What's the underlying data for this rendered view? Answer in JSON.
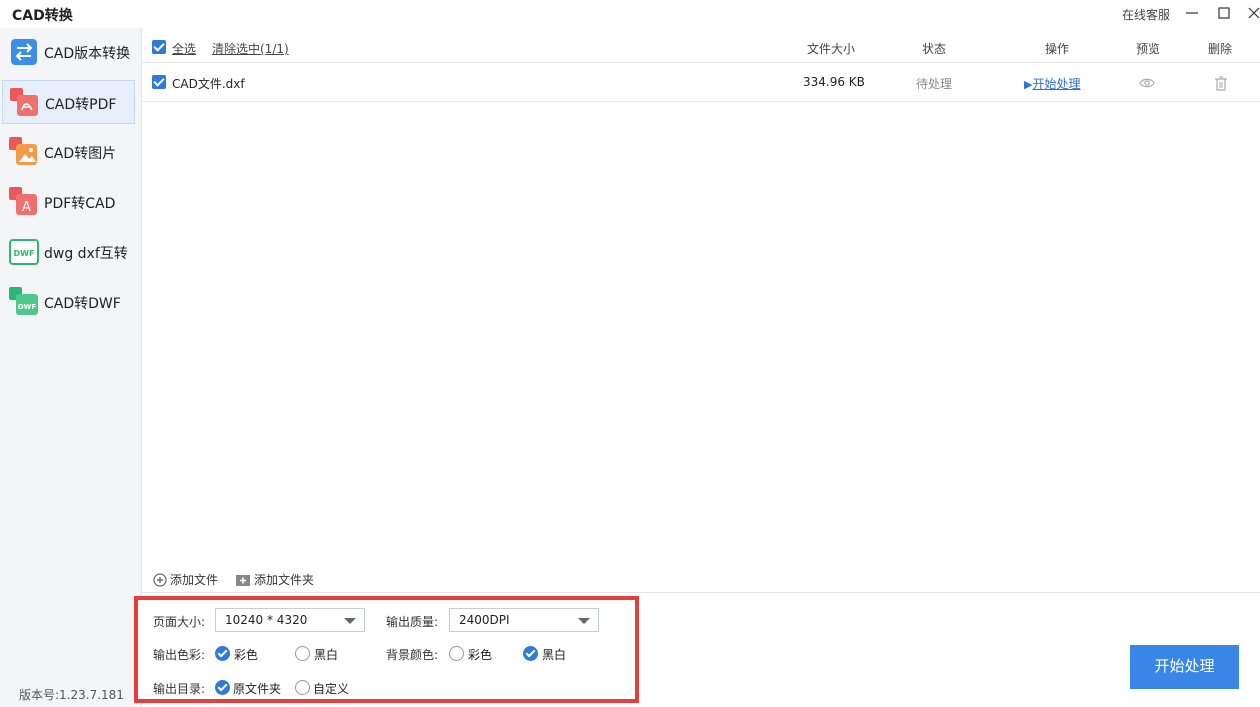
{
  "window": {
    "title": "CAD转换",
    "support_label": "在线客服"
  },
  "sidebar": {
    "items": [
      {
        "label": "CAD版本转换",
        "icon": "version-convert-icon",
        "color": "#3b8de8"
      },
      {
        "label": "CAD转PDF",
        "icon": "pdf-icon",
        "color": "#e85a5a",
        "active": true
      },
      {
        "label": "CAD转图片",
        "icon": "image-icon",
        "color": "#f08a3a"
      },
      {
        "label": "PDF转CAD",
        "icon": "pdf-to-cad-icon",
        "color": "#e85a5a"
      },
      {
        "label": "dwg dxf互转",
        "icon": "dwf-icon",
        "color": "#2bb673"
      },
      {
        "label": "CAD转DWF",
        "icon": "dwf-icon",
        "color": "#2bb673"
      }
    ],
    "version": "版本号:1.23.7.181"
  },
  "table": {
    "select_all": "全选",
    "clear_selection": "清除选中(1/1)",
    "columns": [
      "文件大小",
      "状态",
      "操作",
      "预览",
      "删除"
    ],
    "rows": [
      {
        "name": "CAD文件.dxf",
        "size": "334.96 KB",
        "status": "待处理",
        "action": "开始处理"
      }
    ]
  },
  "footer": {
    "add_file": "添加文件",
    "add_folder": "添加文件夹"
  },
  "options": {
    "page_size_label": "页面大小:",
    "page_size_value": "10240 * 4320",
    "quality_label": "输出质量:",
    "quality_value": "2400DPI",
    "output_color_label": "输出色彩:",
    "output_color_options": [
      "彩色",
      "黑白"
    ],
    "output_color_selected": "彩色",
    "bg_color_label": "背景颜色:",
    "bg_color_options": [
      "彩色",
      "黑白"
    ],
    "bg_color_selected": "黑白",
    "output_dir_label": "输出目录:",
    "output_dir_options": [
      "原文件夹",
      "自定义"
    ],
    "output_dir_selected": "原文件夹"
  },
  "start_button": "开始处理",
  "colors": {
    "accent": "#3a86e6",
    "highlight_border": "#e63d3d"
  }
}
